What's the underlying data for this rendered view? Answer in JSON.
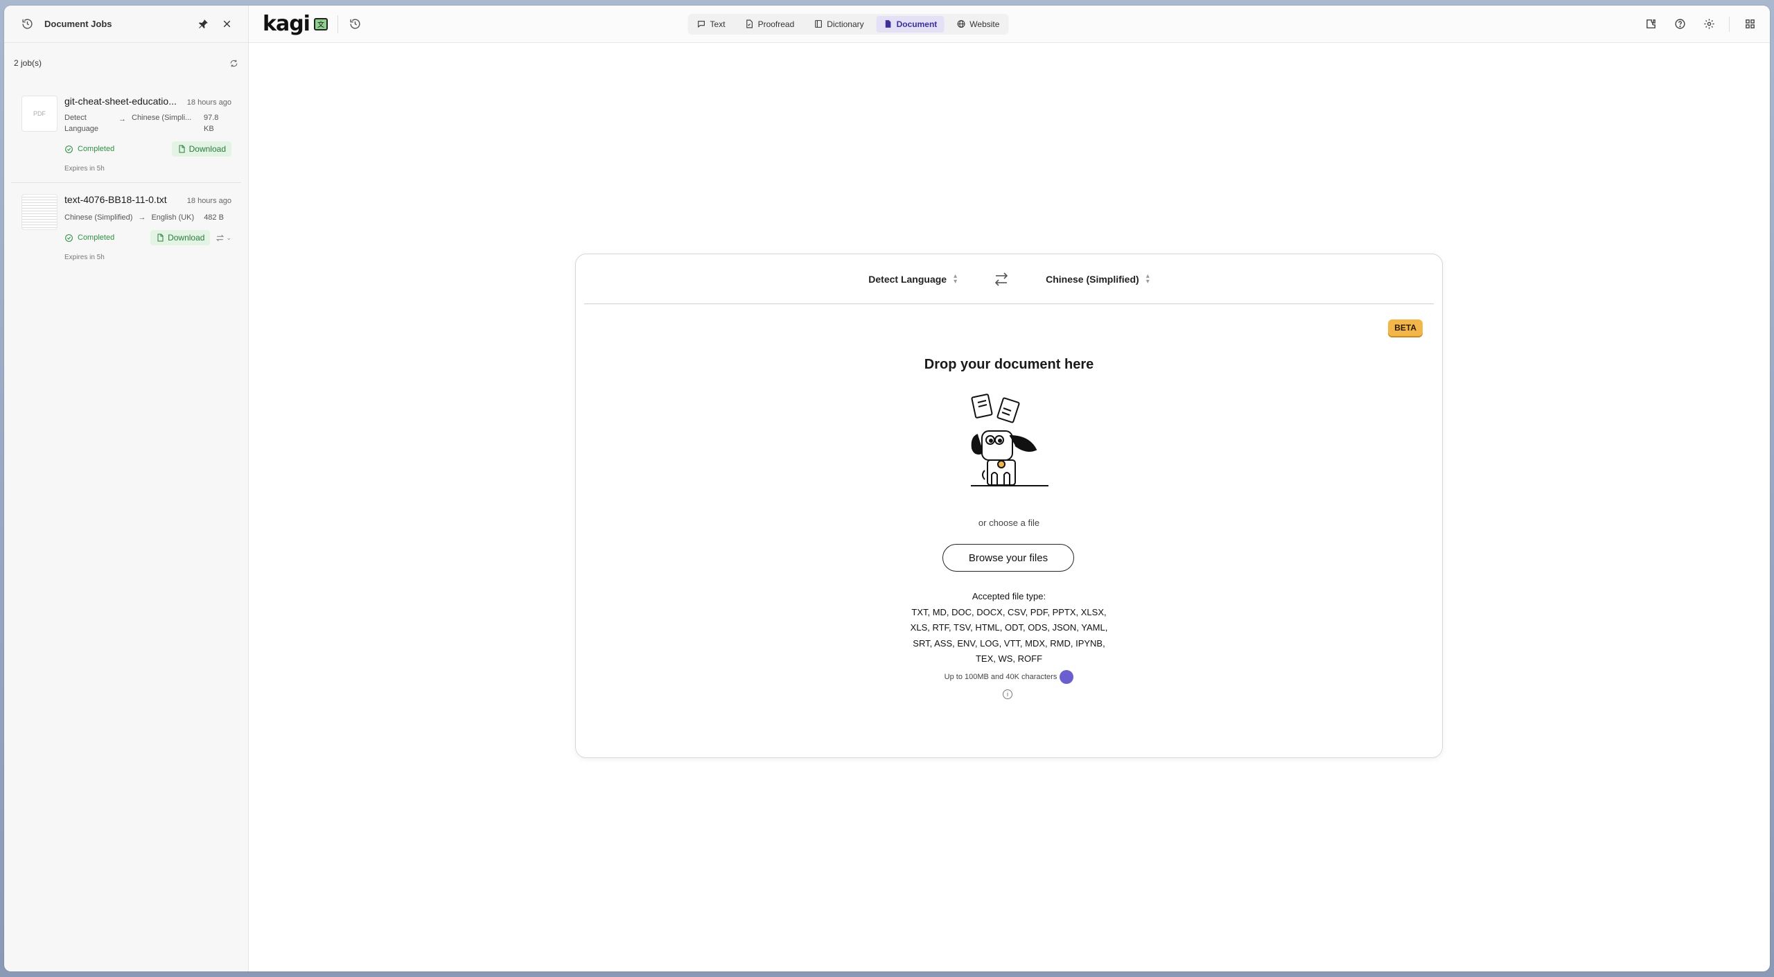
{
  "sidebar": {
    "title": "Document Jobs",
    "job_count": "2 job(s)",
    "jobs": [
      {
        "name": "git-cheat-sheet-educatio...",
        "time": "18 hours ago",
        "thumb": "PDF",
        "source_lang": "Detect Language",
        "target_lang": "Chinese (Simpli...",
        "size": "97.8 KB",
        "status": "Completed",
        "download": "Download",
        "expires": "Expires in 5h"
      },
      {
        "name": "text-4076-BB18-11-0.txt",
        "time": "18 hours ago",
        "source_lang": "Chinese (Simplified)",
        "target_lang": "English (UK)",
        "size": "482 B",
        "status": "Completed",
        "download": "Download",
        "expires": "Expires in 5h"
      }
    ]
  },
  "topbar": {
    "logo": "kagi",
    "nav": [
      {
        "label": "Text",
        "icon": "chat-icon"
      },
      {
        "label": "Proofread",
        "icon": "proofread-icon"
      },
      {
        "label": "Dictionary",
        "icon": "book-icon"
      },
      {
        "label": "Document",
        "icon": "document-icon",
        "active": true
      },
      {
        "label": "Website",
        "icon": "globe-icon"
      }
    ]
  },
  "card": {
    "source_lang": "Detect Language",
    "target_lang": "Chinese (Simplified)",
    "beta": "BETA",
    "drop_title": "Drop your document here",
    "choose": "or choose a file",
    "browse": "Browse your files",
    "accepted_label": "Accepted file type:",
    "accepted_types": "TXT, MD, DOC, DOCX, CSV, PDF, PPTX, XLSX, XLS, RTF, TSV, HTML, ODT, ODS, JSON, YAML, SRT, ASS, ENV, LOG, VTT, MDX, RMD, IPYNB, TEX, WS, ROFF",
    "limit": "Up to 100MB and 40K characters"
  },
  "colors": {
    "accent": "#3b2f9a",
    "nav_active_bg": "#e4e1f7",
    "success": "#2f8f45",
    "download_bg": "#e3f4e5",
    "beta_bg": "#f3b64b"
  }
}
